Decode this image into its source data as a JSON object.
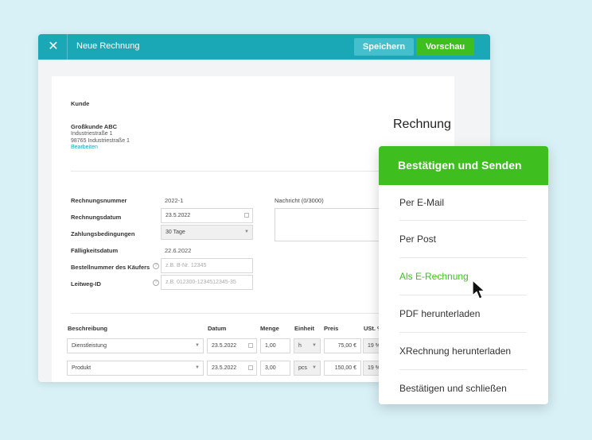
{
  "titlebar": {
    "title": "Neue Rechnung",
    "save_label": "Speichern",
    "preview_label": "Vorschau",
    "close_glyph": "✕"
  },
  "customer": {
    "section_label": "Kunde",
    "name": "Großkunde ABC",
    "street": "Industriestraße 1",
    "city": "98765 Industriestraße 1",
    "edit_link": "Bearbeiten"
  },
  "doc_heading": "Rechnung",
  "form": {
    "invoice_number_label": "Rechnungsnummer",
    "invoice_number": "2022-1",
    "invoice_date_label": "Rechnungsdatum",
    "invoice_date": "23.5.2022",
    "payment_terms_label": "Zahlungsbedingungen",
    "payment_terms": "30 Tage",
    "due_date_label": "Fälligkeitsdatum",
    "due_date": "22.6.2022",
    "order_number_label": "Bestellnummer des Käufers",
    "order_number_placeholder": "z.B. B-Nr. 12345",
    "leitweg_label": "Leitweg-ID",
    "leitweg_placeholder": "z.B. 012300-1234512345-35",
    "message_label": "Nachricht (0/3000)",
    "help_glyph": "?"
  },
  "table": {
    "headers": {
      "description": "Beschreibung",
      "date": "Datum",
      "quantity": "Menge",
      "unit": "Einheit",
      "price": "Preis",
      "vat": "USt. %"
    },
    "rows": [
      {
        "description": "Dienstleistung",
        "date": "23.5.2022",
        "quantity": "1,00",
        "unit": "h",
        "price": "75,00 €",
        "vat": "19 %"
      },
      {
        "description": "Produkt",
        "date": "23.5.2022",
        "quantity": "3,00",
        "unit": "pcs",
        "price": "150,00 €",
        "vat": "19 %"
      }
    ]
  },
  "panel": {
    "title": "Bestätigen und Senden",
    "items": [
      "Per E-Mail",
      "Per Post",
      "Als E-Rechnung",
      "PDF herunterladen",
      "XRechnung herunterladen",
      "Bestätigen und schließen"
    ],
    "active_index": 2
  },
  "colors": {
    "teal": "#1aa8b7",
    "green": "#3fbf1f",
    "background": "#d7f1f7"
  },
  "icons": {
    "close": "close-icon",
    "dropdown": "chevron-down-icon",
    "calendar": "calendar-icon",
    "help": "help-icon",
    "cursor": "mouse-pointer-icon"
  }
}
